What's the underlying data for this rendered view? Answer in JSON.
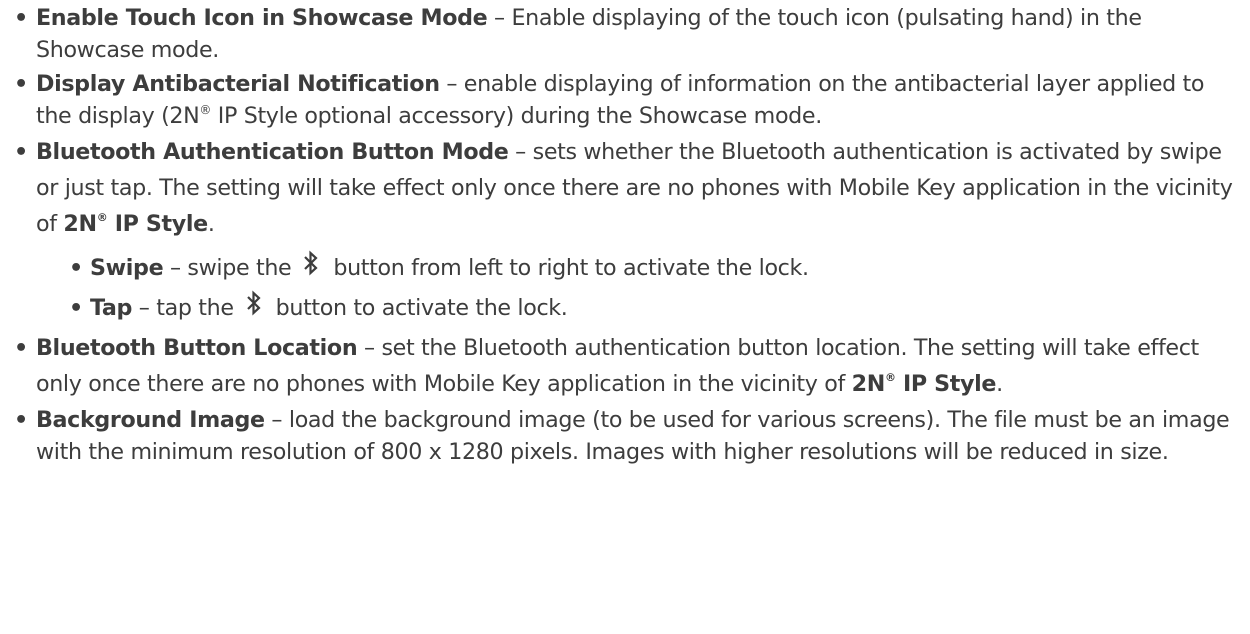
{
  "items": [
    {
      "term": "Enable Touch Icon in Showcase Mode",
      "sep": " – ",
      "desc": "Enable displaying of the touch icon (pulsating hand) in the Showcase mode."
    },
    {
      "term": "Display Antibacterial Notification",
      "sep": " – ",
      "desc_a": "enable displaying of information on the antibacterial layer applied to the display (2N",
      "reg": "®",
      "desc_b": " IP Style optional accessory) during the Showcase mode."
    },
    {
      "term": "Bluetooth Authentication Button Mode",
      "sep": " – ",
      "desc": "sets whether the Bluetooth authentication is activated by swipe or just tap. The setting will take effect only once there are no phones with Mobile Key application in the vicinity of ",
      "product_a": "2N",
      "product_reg": "®",
      "product_b": " IP Style",
      "end": ".",
      "options": [
        {
          "term": "Swipe",
          "sep": " – ",
          "pre": "swipe the",
          "icon": "bluetooth-icon",
          "post": "button from left to right to activate the lock."
        },
        {
          "term": "Tap",
          "sep": " – ",
          "pre": "tap the",
          "icon": "bluetooth-icon",
          "post": "button to activate the lock."
        }
      ]
    },
    {
      "term": "Bluetooth Button Location",
      "sep": " – ",
      "desc": "set the Bluetooth authentication button location. The setting will take effect only once there are no phones with Mobile Key application in the vicinity of ",
      "product_a": "2N",
      "product_reg": "®",
      "product_b": " IP Style",
      "end": "."
    },
    {
      "term": "Background Image",
      "sep": " – ",
      "desc": "load the background image (to be used for various screens). The file must be an image with the minimum resolution of 800 x 1280 pixels. Images with higher resolutions will be reduced in size."
    }
  ]
}
